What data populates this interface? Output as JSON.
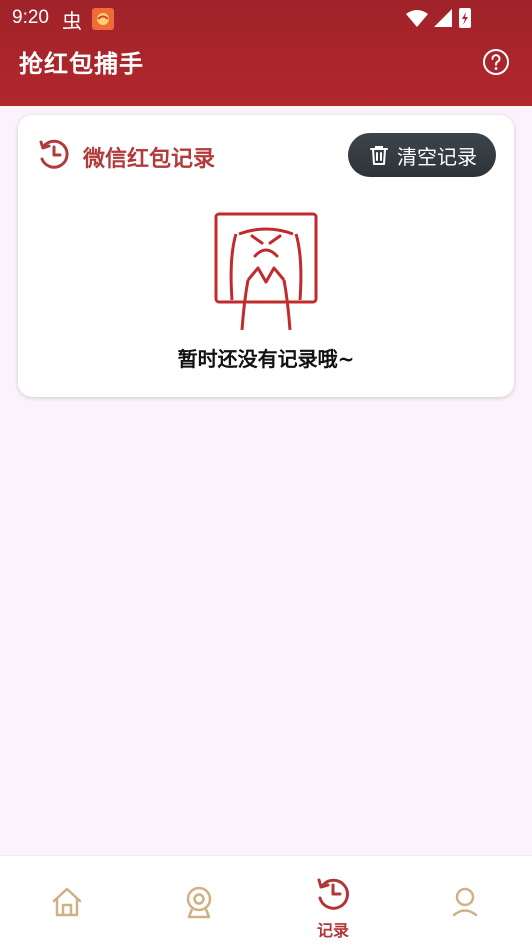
{
  "status": {
    "time": "9:20",
    "glyph": "虫"
  },
  "header": {
    "title": "抢红包捕手",
    "help_icon": "help-circle-icon"
  },
  "card": {
    "title": "微信红包记录",
    "history_icon": "history-icon",
    "clear_button": {
      "label": "清空记录",
      "icon": "trash-icon"
    },
    "empty_text": "暂时还没有记录哦~"
  },
  "bottom_nav": {
    "items": [
      {
        "icon": "home-icon",
        "label": ""
      },
      {
        "icon": "webcam-icon",
        "label": ""
      },
      {
        "icon": "history-icon",
        "label": "记录"
      },
      {
        "icon": "profile-icon",
        "label": ""
      }
    ]
  },
  "colors": {
    "header_red": "#a7252b",
    "accent_red": "#b23a3a",
    "nav_gold": "#cfb183",
    "button_dark": "#363d43"
  }
}
